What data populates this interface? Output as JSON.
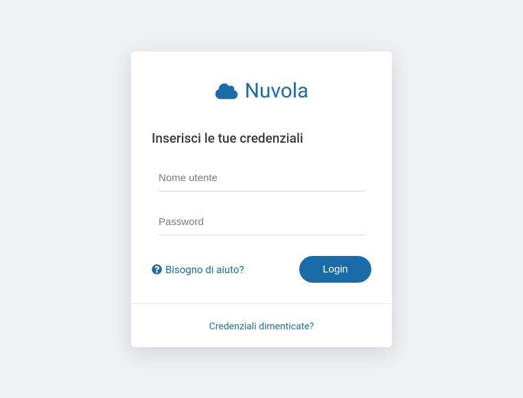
{
  "logo": {
    "text": "Nuvola"
  },
  "subtitle": "Inserisci le tue credenziali",
  "fields": {
    "username": {
      "placeholder": "Nome utente",
      "value": ""
    },
    "password": {
      "placeholder": "Password",
      "value": ""
    }
  },
  "help_link": "Bisogno di aiuto?",
  "login_button": "Login",
  "forgot_link": "Credenziali dimenticate?",
  "colors": {
    "accent": "#1a6ca8",
    "background": "#eef1f4"
  }
}
